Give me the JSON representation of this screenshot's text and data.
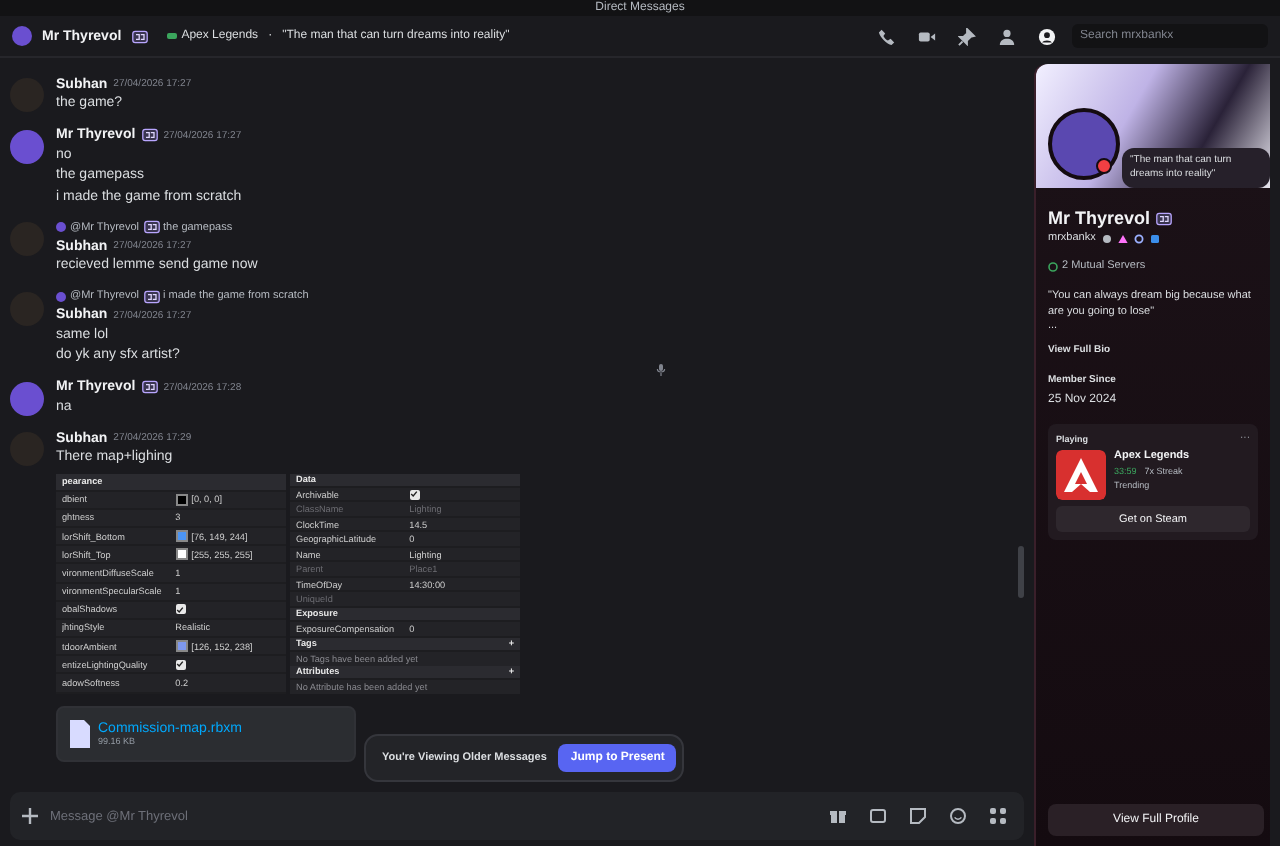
{
  "window": {
    "title": "Direct Messages"
  },
  "header": {
    "name": "Mr Thyrevol",
    "game": "Apex Legends",
    "separator": "·",
    "status": "\"The man that can turn dreams into reality\"",
    "search_placeholder": "Search mrxbankx"
  },
  "messages": [
    {
      "author": "Subhan",
      "color": "#2a2522",
      "time": "27/04/2026 17:27",
      "lines": [
        "the game?"
      ]
    },
    {
      "author": "Mr Thyrevol",
      "color": "#6a4fd0",
      "time": "27/04/2026 17:27",
      "lines": [
        "no",
        "the gamepass",
        "i made the game from scratch"
      ]
    },
    {
      "author": "Subhan",
      "color": "#2a2522",
      "time": "27/04/2026 17:27",
      "reply": {
        "author": "@Mr Thyrevol",
        "text": "the gamepass"
      },
      "lines": [
        "recieved lemme send game now"
      ]
    },
    {
      "author": "Subhan",
      "color": "#2a2522",
      "time": "27/04/2026 17:27",
      "reply": {
        "author": "@Mr Thyrevol",
        "text": "i made the game from scratch"
      },
      "lines": [
        "same lol",
        "do yk any sfx artist?"
      ]
    },
    {
      "author": "Mr Thyrevol",
      "color": "#6a4fd0",
      "time": "27/04/2026 17:28",
      "lines": [
        "na"
      ]
    },
    {
      "author": "Subhan",
      "color": "#2a2522",
      "time": "27/04/2026 17:29",
      "lines": [
        "There map+lighing"
      ],
      "properties": {
        "left": [
          {
            "kind": "header",
            "label": "pearance"
          },
          {
            "kind": "color",
            "label": "dbient",
            "value": "[0, 0, 0]",
            "color": "#000000"
          },
          {
            "kind": "value",
            "label": "ghtness",
            "value": "3"
          },
          {
            "kind": "color",
            "label": "lorShift_Bottom",
            "value": "[76, 149, 244]",
            "color": "#4c95f4"
          },
          {
            "kind": "color",
            "label": "lorShift_Top",
            "value": "[255, 255, 255]",
            "color": "#ffffff"
          },
          {
            "kind": "value",
            "label": "vironmentDiffuseScale",
            "value": "1"
          },
          {
            "kind": "value",
            "label": "vironmentSpecularScale",
            "value": "1"
          },
          {
            "kind": "checkbox",
            "label": "obalShadows",
            "checked": true
          },
          {
            "kind": "value",
            "label": "jhtingStyle",
            "value": "Realistic"
          },
          {
            "kind": "color",
            "label": "tdoorAmbient",
            "value": "[126, 152, 238]",
            "color": "#7e98ee"
          },
          {
            "kind": "checkbox",
            "label": "entizeLightingQuality",
            "checked": true
          },
          {
            "kind": "value",
            "label": "adowSoftness",
            "value": "0.2"
          }
        ],
        "right": [
          {
            "kind": "header",
            "label": "Data"
          },
          {
            "kind": "checkbox",
            "label": "Archivable",
            "checked": true
          },
          {
            "kind": "value",
            "label": "ClassName",
            "value": "Lighting",
            "disabled": true
          },
          {
            "kind": "value",
            "label": "ClockTime",
            "value": "14.5",
            "disabled": false
          },
          {
            "kind": "value",
            "label": "GeographicLatitude",
            "value": "0",
            "disabled": false
          },
          {
            "kind": "value",
            "label": "Name",
            "value": "Lighting",
            "disabled": false
          },
          {
            "kind": "value",
            "label": "Parent",
            "value": "Place1",
            "disabled": true
          },
          {
            "kind": "value",
            "label": "TimeOfDay",
            "value": "14:30:00",
            "disabled": false
          },
          {
            "kind": "value",
            "label": "UniqueId",
            "disabled": true
          },
          {
            "kind": "header",
            "label": "Exposure"
          },
          {
            "kind": "value",
            "label": "ExposureCompensation",
            "value": "0",
            "disabled": false
          },
          {
            "kind": "section",
            "label": "Tags",
            "add": "+"
          },
          {
            "kind": "note",
            "label": "No Tags have been added yet"
          },
          {
            "kind": "section",
            "label": "Attributes",
            "add": "+"
          },
          {
            "kind": "note",
            "label": "No Attribute has been added yet"
          }
        ]
      },
      "file": {
        "name": "Commission-map.rbxm",
        "size": "99.16 KB"
      }
    }
  ],
  "notice": {
    "text": "You're Viewing Older Messages",
    "button": "Jump to Present"
  },
  "input": {
    "placeholder": "Message @Mr Thyrevol"
  },
  "profile": {
    "status": "\"The man that can turn dreams into reality\"",
    "name": "Mr Thyrevol",
    "username": "mrxbankx",
    "mutual": "2 Mutual Servers",
    "bio": "\"You can always dream big because what are you going to lose\"",
    "bio_more": "...",
    "view_bio": "View Full Bio",
    "member_label": "Member Since",
    "member_date": "25 Nov 2024",
    "activity": {
      "label": "Playing",
      "more": "···",
      "game": "Apex Legends",
      "time": "33:59",
      "streak": "7x Streak",
      "trending": "Trending",
      "button": "Get on Steam"
    },
    "full_profile": "View Full Profile"
  }
}
